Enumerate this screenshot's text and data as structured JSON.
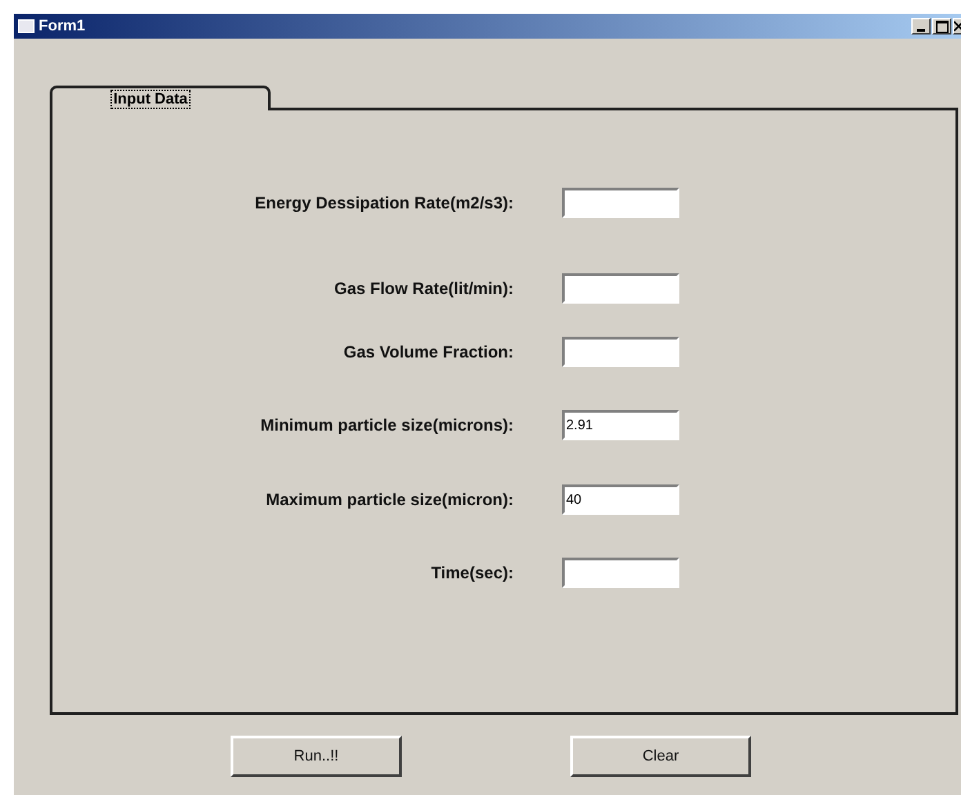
{
  "window": {
    "title": "Form1"
  },
  "tabs": [
    {
      "label": "Input Data",
      "selected": true
    }
  ],
  "fields": [
    {
      "label": "Energy Dessipation Rate(m2/s3):"
    },
    {
      "label": "Gas Flow Rate(lit/min):"
    },
    {
      "label": "Gas Volume Fraction:"
    },
    {
      "label": "Minimum particle size(microns):",
      "value": "2.91"
    },
    {
      "label": "Maximum particle size(micron):",
      "value": "40"
    },
    {
      "label": "Time(sec):"
    }
  ],
  "buttons": [
    "Run..!!",
    "Clear"
  ]
}
